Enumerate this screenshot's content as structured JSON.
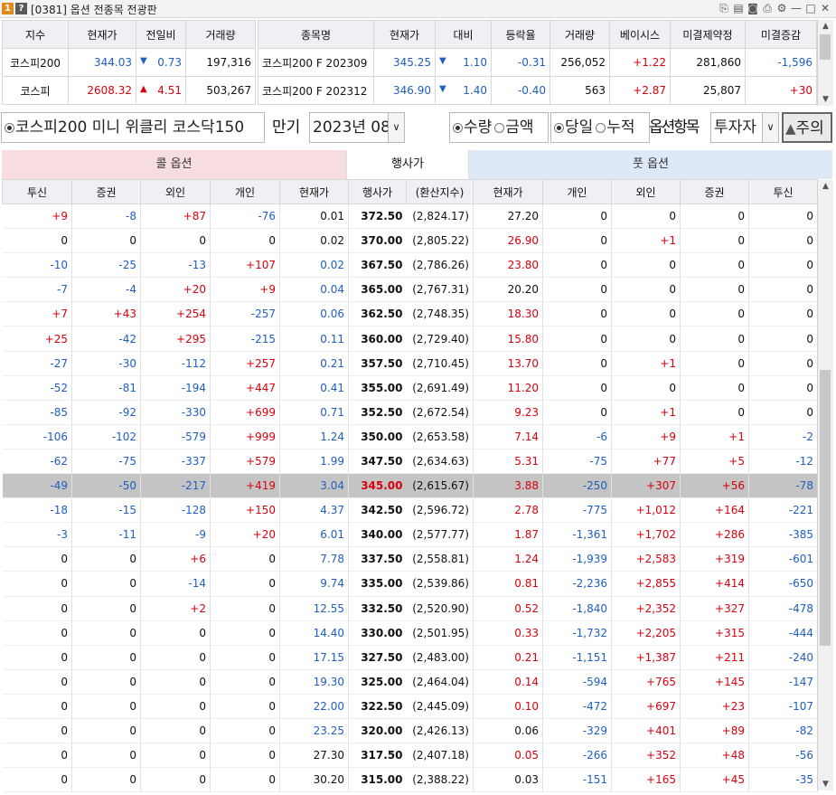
{
  "title": {
    "badge1": "1",
    "badge2": "?",
    "text": "[0381] 옵션 전종목 전광판"
  },
  "index_table": {
    "headers": [
      "지수",
      "현재가",
      "전일비",
      "거래량"
    ],
    "rows": [
      {
        "name": "코스피200",
        "price": "344.03",
        "arrow": "▼",
        "dir": "dn",
        "change": "0.73",
        "volume": "197,316"
      },
      {
        "name": "코스피",
        "price": "2608.32",
        "arrow": "▲",
        "dir": "up",
        "change": "4.51",
        "volume": "503,267"
      }
    ]
  },
  "futures_table": {
    "headers": [
      "종목명",
      "현재가",
      "대비",
      "등락율",
      "거래량",
      "베이시스",
      "미결제약정",
      "미결증감"
    ],
    "rows": [
      {
        "name": "코스피200 F 202309",
        "price": "345.25",
        "arrow": "▼",
        "change": "1.10",
        "rate": "-0.31",
        "volume": "256,052",
        "basis": "+1.22",
        "oi": "281,860",
        "oi_chg": "-1,596"
      },
      {
        "name": "코스피200 F 202312",
        "price": "346.90",
        "arrow": "▼",
        "change": "1.40",
        "rate": "-0.40",
        "volume": "563",
        "basis": "+2.87",
        "oi": "25,807",
        "oi_chg": "+30"
      }
    ]
  },
  "controls": {
    "market_radios": "코스피200  미니  위클리  코스닥150",
    "expiry_label": "만기",
    "expiry_value": "2023년 08",
    "unit_radios": [
      "수량",
      "금액"
    ],
    "period_radios": [
      "당일",
      "누적"
    ],
    "option_label": "옵션항목",
    "investor_value": "투자자",
    "notice_button": "주의"
  },
  "bands": {
    "call": "콜 옵션",
    "strike": "행사가",
    "put": "풋 옵션"
  },
  "grid": {
    "headers": [
      "투신",
      "증권",
      "외인",
      "개인",
      "현재가",
      "행사가",
      "(환산지수)",
      "현재가",
      "개인",
      "외인",
      "증권",
      "투신"
    ],
    "atm_index": 11,
    "rows": [
      [
        "+9",
        "-8",
        "+87",
        "-76",
        "0.01",
        "372.50",
        "(2,824.17)",
        "27.20",
        "0",
        "0",
        "0",
        "0"
      ],
      [
        "0",
        "0",
        "0",
        "0",
        "0.02",
        "370.00",
        "(2,805.22)",
        "26.90",
        "0",
        "+1",
        "0",
        "0"
      ],
      [
        "-10",
        "-25",
        "-13",
        "+107",
        "0.02",
        "367.50",
        "(2,786.26)",
        "23.80",
        "0",
        "0",
        "0",
        "0"
      ],
      [
        "-7",
        "-4",
        "+20",
        "+9",
        "0.04",
        "365.00",
        "(2,767.31)",
        "20.20",
        "0",
        "0",
        "0",
        "0"
      ],
      [
        "+7",
        "+43",
        "+254",
        "-257",
        "0.06",
        "362.50",
        "(2,748.35)",
        "18.30",
        "0",
        "0",
        "0",
        "0"
      ],
      [
        "+25",
        "-42",
        "+295",
        "-215",
        "0.11",
        "360.00",
        "(2,729.40)",
        "15.80",
        "0",
        "0",
        "0",
        "0"
      ],
      [
        "-27",
        "-30",
        "-112",
        "+257",
        "0.21",
        "357.50",
        "(2,710.45)",
        "13.70",
        "0",
        "+1",
        "0",
        "0"
      ],
      [
        "-52",
        "-81",
        "-194",
        "+447",
        "0.41",
        "355.00",
        "(2,691.49)",
        "11.20",
        "0",
        "0",
        "0",
        "0"
      ],
      [
        "-85",
        "-92",
        "-330",
        "+699",
        "0.71",
        "352.50",
        "(2,672.54)",
        "9.23",
        "0",
        "+1",
        "0",
        "0"
      ],
      [
        "-106",
        "-102",
        "-579",
        "+999",
        "1.24",
        "350.00",
        "(2,653.58)",
        "7.14",
        "-6",
        "+9",
        "+1",
        "-2"
      ],
      [
        "-62",
        "-75",
        "-337",
        "+579",
        "1.99",
        "347.50",
        "(2,634.63)",
        "5.31",
        "-75",
        "+77",
        "+5",
        "-12"
      ],
      [
        "-49",
        "-50",
        "-217",
        "+419",
        "3.04",
        "345.00",
        "(2,615.67)",
        "3.88",
        "-250",
        "+307",
        "+56",
        "-78"
      ],
      [
        "-18",
        "-15",
        "-128",
        "+150",
        "4.37",
        "342.50",
        "(2,596.72)",
        "2.78",
        "-775",
        "+1,012",
        "+164",
        "-221"
      ],
      [
        "-3",
        "-11",
        "-9",
        "+20",
        "6.01",
        "340.00",
        "(2,577.77)",
        "1.87",
        "-1,361",
        "+1,702",
        "+286",
        "-385"
      ],
      [
        "0",
        "0",
        "+6",
        "0",
        "7.78",
        "337.50",
        "(2,558.81)",
        "1.24",
        "-1,939",
        "+2,583",
        "+319",
        "-601"
      ],
      [
        "0",
        "0",
        "-14",
        "0",
        "9.74",
        "335.00",
        "(2,539.86)",
        "0.81",
        "-2,236",
        "+2,855",
        "+414",
        "-650"
      ],
      [
        "0",
        "0",
        "+2",
        "0",
        "12.55",
        "332.50",
        "(2,520.90)",
        "0.52",
        "-1,840",
        "+2,352",
        "+327",
        "-478"
      ],
      [
        "0",
        "0",
        "0",
        "0",
        "14.40",
        "330.00",
        "(2,501.95)",
        "0.33",
        "-1,732",
        "+2,205",
        "+315",
        "-444"
      ],
      [
        "0",
        "0",
        "0",
        "0",
        "17.15",
        "327.50",
        "(2,483.00)",
        "0.21",
        "-1,151",
        "+1,387",
        "+211",
        "-240"
      ],
      [
        "0",
        "0",
        "0",
        "0",
        "19.30",
        "325.00",
        "(2,464.04)",
        "0.14",
        "-594",
        "+765",
        "+145",
        "-147"
      ],
      [
        "0",
        "0",
        "0",
        "0",
        "22.00",
        "322.50",
        "(2,445.09)",
        "0.10",
        "-472",
        "+697",
        "+23",
        "-107"
      ],
      [
        "0",
        "0",
        "0",
        "0",
        "23.25",
        "320.00",
        "(2,426.13)",
        "0.06",
        "-329",
        "+401",
        "+89",
        "-82"
      ],
      [
        "0",
        "0",
        "0",
        "0",
        "27.30",
        "317.50",
        "(2,407.18)",
        "0.05",
        "-266",
        "+352",
        "+48",
        "-56"
      ],
      [
        "0",
        "0",
        "0",
        "0",
        "30.20",
        "315.00",
        "(2,388.22)",
        "0.03",
        "-151",
        "+165",
        "+45",
        "-35"
      ]
    ],
    "call_price_colors": [
      "blk",
      "blk",
      "dn",
      "dn",
      "dn",
      "dn",
      "dn",
      "dn",
      "dn",
      "dn",
      "dn",
      "dn",
      "dn",
      "dn",
      "dn",
      "dn",
      "dn",
      "dn",
      "dn",
      "dn",
      "dn",
      "dn",
      "blk",
      "blk"
    ],
    "put_price_colors": [
      "blk",
      "up",
      "up",
      "blk",
      "up",
      "up",
      "up",
      "up",
      "up",
      "up",
      "up",
      "up",
      "up",
      "up",
      "up",
      "up",
      "up",
      "up",
      "up",
      "up",
      "up",
      "blk",
      "up",
      "blk"
    ]
  },
  "colors": {
    "call_band": "#f7dde0",
    "put_band": "#dde9f7",
    "up": "#d8000c",
    "down": "#1f5fbf"
  }
}
